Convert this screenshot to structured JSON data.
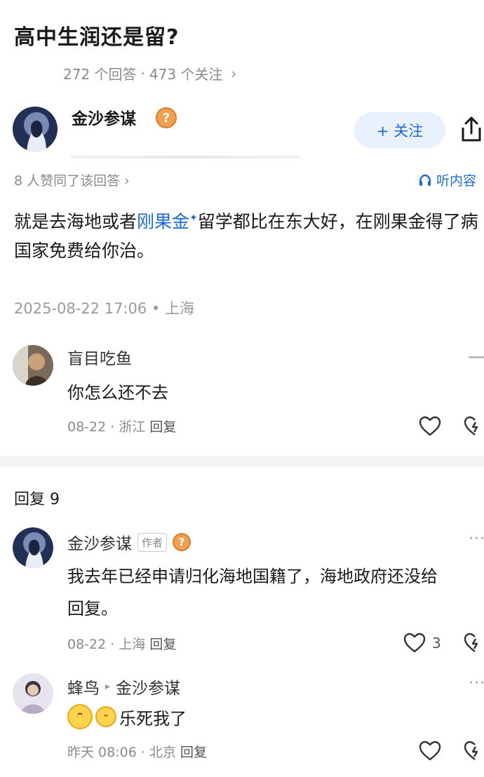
{
  "question": {
    "title": "高中生润还是留?",
    "answers_text": "272 个回答",
    "dot": "·",
    "followers_text": "473 个关注",
    "arrow": "›"
  },
  "answer": {
    "author": "金沙参谋",
    "follow_label": "+ 关注",
    "liked_text": "8 人赞同了该回答 ›",
    "listen_label": "听内容",
    "text_part1": "就是去海地或者",
    "text_link": "刚果金",
    "text_part2": "留学都比在东大好，在刚果金得了病国家免费给你治。",
    "time_location": "2025-08-22 17:06 • 上海"
  },
  "top_comment": {
    "name": "盲目吃鱼",
    "text": "你怎么还不去",
    "meta": "08-22 · 浙江",
    "reply_label": "回复"
  },
  "replies": {
    "header": "回复 9",
    "items": [
      {
        "name": "金沙参谋",
        "tag": "作者",
        "text_line1": "我去年已经申请归化海地国籍了，海地政府还没给",
        "text_line2": "回复。",
        "meta": "08-22 · 上海",
        "reply_label": "回复",
        "likes": "3"
      },
      {
        "name": "蜂鸟",
        "reply_to_arrow": "▸",
        "reply_to": "金沙参谋",
        "text": "乐死我了",
        "meta": "昨天 08:06 · 北京",
        "reply_label": "回复"
      }
    ]
  },
  "colors": {
    "accent": "#1a6bd6",
    "follow_bg": "#e9f1ff",
    "muted": "#8a8a8a"
  },
  "icons": [
    "share-icon",
    "headphone-icon",
    "heart-icon",
    "share-forward-icon",
    "more-icon",
    "laughing-emoji-icon",
    "grin-emoji-icon"
  ]
}
